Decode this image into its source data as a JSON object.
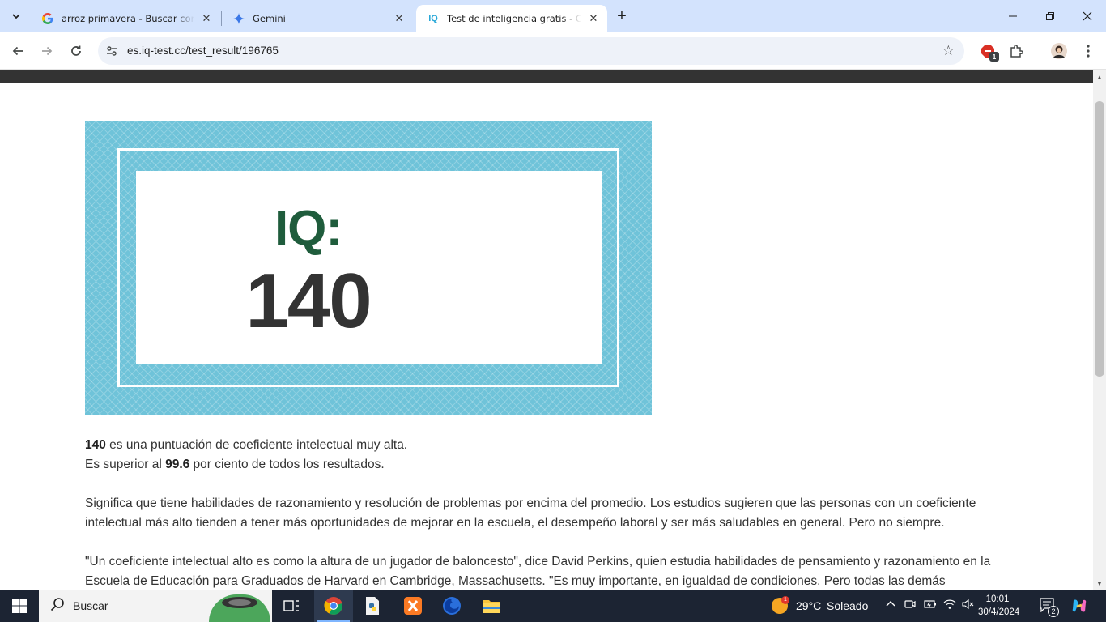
{
  "browser": {
    "tabs": [
      {
        "title": "arroz primavera - Buscar con Google",
        "favicon": "google-g-icon",
        "active": false
      },
      {
        "title": "Gemini",
        "favicon": "gemini-sparkle-icon",
        "active": false
      },
      {
        "title": "Test de inteligencia gratis - Calculadora de IQ",
        "favicon": "iq-test-icon",
        "favicon_text": "IQ",
        "active": true
      }
    ],
    "url": "es.iq-test.cc/test_result/196765",
    "extension_badge": "1"
  },
  "result": {
    "iq_label": "IQ:",
    "iq_value": "140"
  },
  "content": {
    "line1_score": "140",
    "line1_rest": " es una puntuación de coeficiente intelectual muy alta.",
    "line2_pre": "Es superior al ",
    "line2_percent": "99.6",
    "line2_post": " por ciento de todos los resultados.",
    "paragraph2": "Significa que tiene habilidades de razonamiento y resolución de problemas por encima del promedio. Los estudios sugieren que las personas con un coeficiente intelectual más alto tienden a tener más oportunidades de mejorar en la escuela, el desempeño laboral y ser más saludables en general. Pero no siempre.",
    "paragraph3": "\"Un coeficiente intelectual alto es como la altura de un jugador de baloncesto\", dice David Perkins, quien estudia habilidades de pensamiento y razonamiento en la Escuela de Educación para Graduados de Harvard en Cambridge, Massachusetts. \"Es muy importante, en igualdad de condiciones. Pero todas las demás"
  },
  "taskbar": {
    "search_label": "Buscar",
    "weather_temp": "29°C",
    "weather_desc": "Soleado",
    "weather_badge": "1",
    "time": "10:01",
    "date": "30/4/2024",
    "notification_count": "2"
  },
  "colors": {
    "banner_bg": "#6fc3d9",
    "iq_label": "#1f5c3c",
    "iq_value": "#333333",
    "tab_strip": "#d3e3fd",
    "taskbar": "#1c2433"
  }
}
